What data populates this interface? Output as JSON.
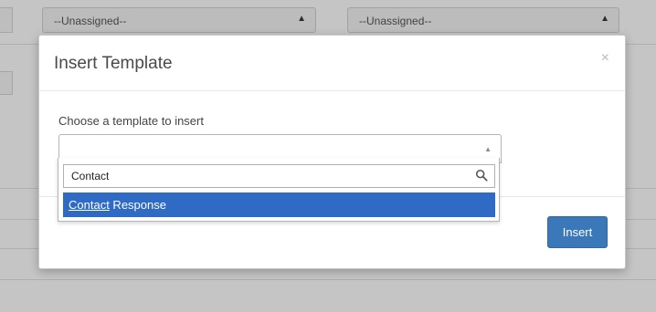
{
  "background": {
    "select_left": "--Unassigned--",
    "select_right": "--Unassigned--"
  },
  "modal": {
    "title": "Insert Template",
    "close_glyph": "×",
    "field_label": "Choose a template to insert",
    "select_value": "",
    "search_value": "Contact",
    "result_match": "Contact",
    "result_rest": " Response",
    "insert_label": "Insert"
  },
  "colors": {
    "accent": "#3a78b9",
    "highlight": "#2f6ac4"
  },
  "icons": {
    "search": "search-icon",
    "close": "close-icon",
    "caret": "caret-up-icon",
    "sort": "sort-icon"
  }
}
